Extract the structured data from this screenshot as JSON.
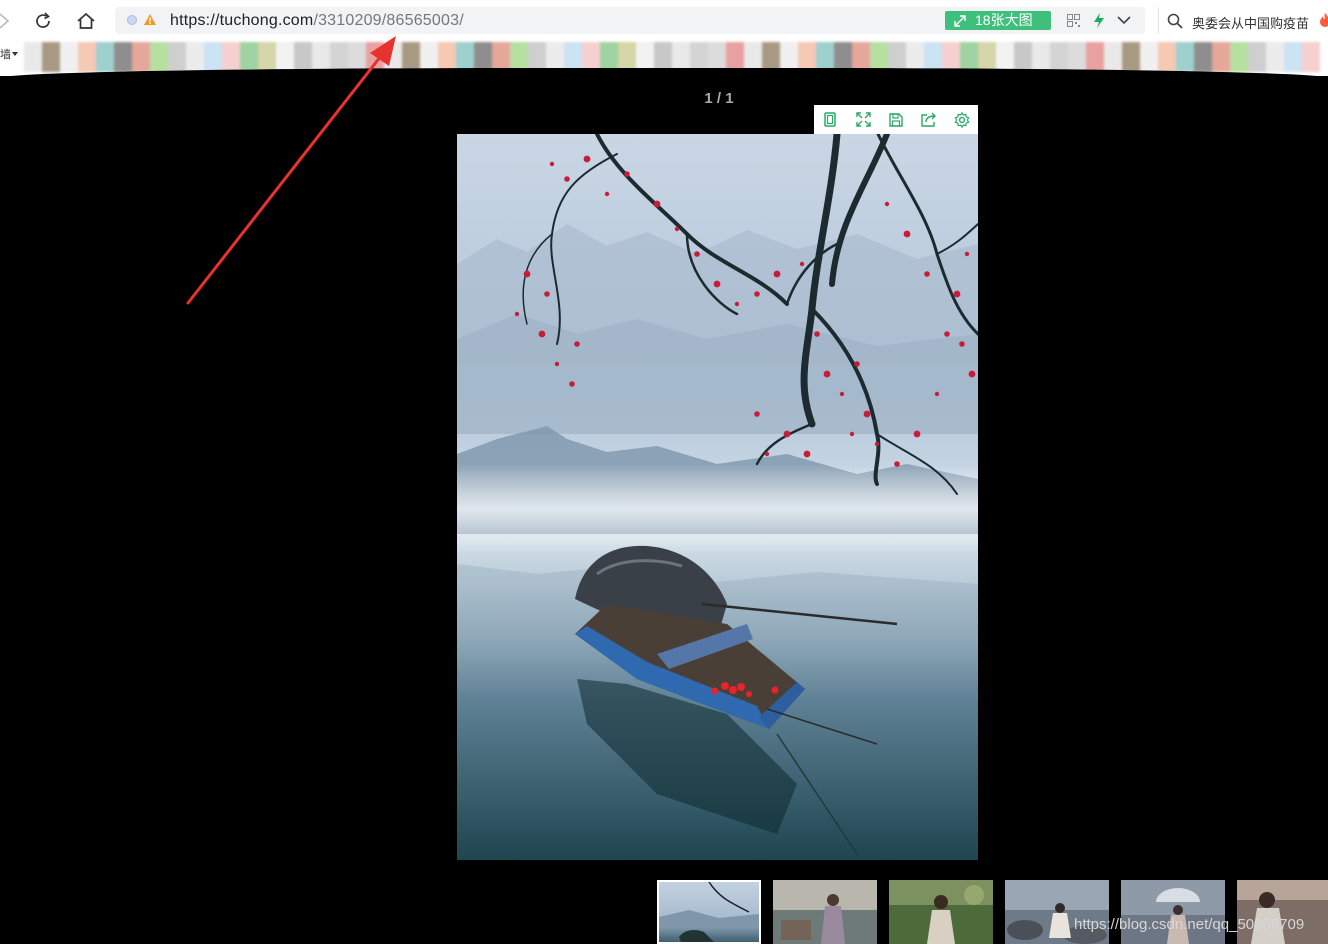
{
  "browser": {
    "address_bar": {
      "url_host": "https://tuchong.com",
      "url_path": "/3310209/86565003/",
      "big_image_label": "18张大图"
    },
    "search": {
      "placeholder": "奥委会从中国购疫苗"
    },
    "bookmark_bar": {
      "left_label": "墙"
    }
  },
  "viewer": {
    "counter": "1 / 1",
    "tools": [
      "original-size-icon",
      "fullscreen-icon",
      "save-icon",
      "share-icon",
      "settings-icon"
    ],
    "thumbnails": [
      {
        "name": "boat-in-mist",
        "active": true
      },
      {
        "name": "girl-by-lake",
        "active": false
      },
      {
        "name": "girl-in-field",
        "active": false
      },
      {
        "name": "woman-on-rocks",
        "active": false
      },
      {
        "name": "woman-with-umbrella",
        "active": false
      },
      {
        "name": "portrait-partial",
        "active": false
      }
    ]
  },
  "watermark": "https://blog.csdn.net/qq_50958709",
  "colors": {
    "accent_green": "#3ec07c",
    "annotation_red": "#e8322e",
    "background": "#000000"
  }
}
